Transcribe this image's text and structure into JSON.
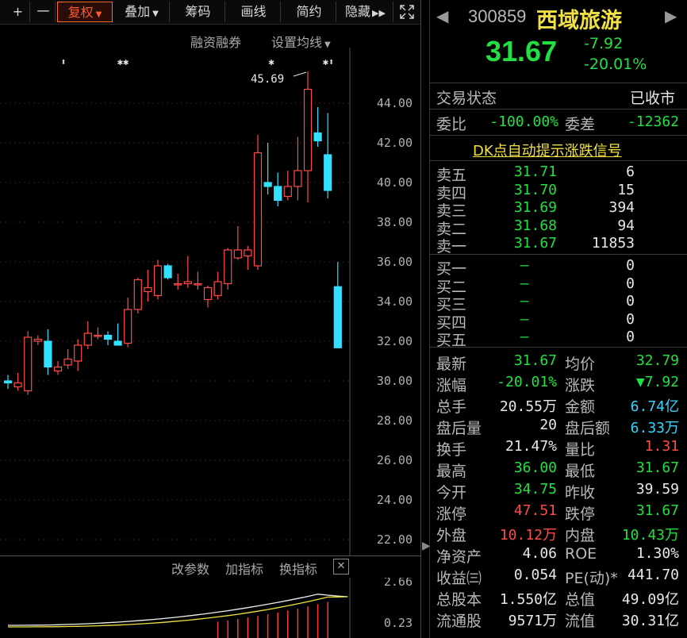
{
  "toolbar": {
    "plus": "+",
    "minus": "一",
    "fuquan": "复权",
    "diejia": "叠加",
    "chouma": "筹码",
    "huaxian": "画线",
    "jianyue": "简约",
    "yincang": "隐藏",
    "expand_icon": "expand-icon"
  },
  "chart_header": {
    "margin_trading": "融资融券",
    "set_ma": "设置均线"
  },
  "chart_data": {
    "type": "candlestick",
    "y_ticks": [
      "44.00",
      "42.00",
      "40.00",
      "38.00",
      "36.00",
      "34.00",
      "32.00",
      "30.00",
      "28.00",
      "26.00",
      "24.00",
      "22.00"
    ],
    "ylim": [
      21.2,
      46.8
    ],
    "high_annotation": "45.69",
    "candles": [
      {
        "o": 30.0,
        "h": 30.3,
        "l": 29.6,
        "c": 29.9
      },
      {
        "o": 29.7,
        "h": 30.4,
        "l": 29.5,
        "c": 29.9
      },
      {
        "o": 29.5,
        "h": 32.5,
        "l": 29.3,
        "c": 32.2
      },
      {
        "o": 32.0,
        "h": 32.3,
        "l": 31.8,
        "c": 32.1
      },
      {
        "o": 32.0,
        "h": 32.6,
        "l": 30.3,
        "c": 30.7
      },
      {
        "o": 30.5,
        "h": 31.0,
        "l": 30.3,
        "c": 30.7
      },
      {
        "o": 30.8,
        "h": 31.6,
        "l": 30.6,
        "c": 31.1
      },
      {
        "o": 31.0,
        "h": 32.1,
        "l": 30.5,
        "c": 31.8
      },
      {
        "o": 31.8,
        "h": 33.0,
        "l": 31.6,
        "c": 32.4
      },
      {
        "o": 32.3,
        "h": 32.7,
        "l": 32.1,
        "c": 32.3
      },
      {
        "o": 32.3,
        "h": 32.5,
        "l": 31.8,
        "c": 32.1
      },
      {
        "o": 32.0,
        "h": 32.9,
        "l": 31.8,
        "c": 31.8
      },
      {
        "o": 31.9,
        "h": 34.2,
        "l": 31.7,
        "c": 33.6
      },
      {
        "o": 33.6,
        "h": 35.2,
        "l": 33.4,
        "c": 35.1
      },
      {
        "o": 34.5,
        "h": 35.6,
        "l": 34.0,
        "c": 34.7
      },
      {
        "o": 34.3,
        "h": 36.1,
        "l": 34.1,
        "c": 35.8
      },
      {
        "o": 35.8,
        "h": 35.9,
        "l": 35.1,
        "c": 35.2
      },
      {
        "o": 34.9,
        "h": 35.4,
        "l": 34.6,
        "c": 34.9
      },
      {
        "o": 34.9,
        "h": 36.3,
        "l": 34.7,
        "c": 35.0
      },
      {
        "o": 34.9,
        "h": 35.5,
        "l": 34.6,
        "c": 34.9
      },
      {
        "o": 34.1,
        "h": 34.8,
        "l": 33.7,
        "c": 34.7
      },
      {
        "o": 34.3,
        "h": 35.5,
        "l": 34.1,
        "c": 35.0
      },
      {
        "o": 34.9,
        "h": 36.7,
        "l": 34.6,
        "c": 36.6
      },
      {
        "o": 36.2,
        "h": 37.8,
        "l": 36.1,
        "c": 36.6
      },
      {
        "o": 36.3,
        "h": 36.8,
        "l": 35.6,
        "c": 36.6
      },
      {
        "o": 35.8,
        "h": 42.4,
        "l": 35.6,
        "c": 41.5
      },
      {
        "o": 40.0,
        "h": 42.0,
        "l": 39.4,
        "c": 39.8
      },
      {
        "o": 39.8,
        "h": 40.5,
        "l": 38.8,
        "c": 39.1
      },
      {
        "o": 39.3,
        "h": 40.6,
        "l": 39.1,
        "c": 39.8
      },
      {
        "o": 39.8,
        "h": 42.3,
        "l": 39.1,
        "c": 40.6
      },
      {
        "o": 40.6,
        "h": 45.6,
        "l": 39.0,
        "c": 44.7
      },
      {
        "o": 42.5,
        "h": 43.8,
        "l": 41.8,
        "c": 42.1
      },
      {
        "o": 41.4,
        "h": 43.5,
        "l": 39.2,
        "c": 39.6
      },
      {
        "o": 34.75,
        "h": 36.0,
        "l": 31.67,
        "c": 31.67
      }
    ],
    "indicator": {
      "y_ticks": [
        "2.66",
        "0.23"
      ],
      "toolbar": [
        "改参数",
        "加指标",
        "换指标"
      ]
    }
  },
  "quote": {
    "code": "300859",
    "name": "西域旅游",
    "price": "31.67",
    "change": "-7.92",
    "change_pct": "-20.01%",
    "status_label": "交易状态",
    "status_value": "已收市",
    "weibi_label": "委比",
    "weibi_value": "-100.00%",
    "weicha_label": "委差",
    "weicha_value": "-12362",
    "dk_link": "DK点自动提示涨跌信号"
  },
  "sell": [
    {
      "label": "卖五",
      "price": "31.71",
      "vol": "6"
    },
    {
      "label": "卖四",
      "price": "31.70",
      "vol": "15"
    },
    {
      "label": "卖三",
      "price": "31.69",
      "vol": "394"
    },
    {
      "label": "卖二",
      "price": "31.68",
      "vol": "94"
    },
    {
      "label": "卖一",
      "price": "31.67",
      "vol": "11853"
    }
  ],
  "buy": [
    {
      "label": "买一",
      "price": "—",
      "vol": "0"
    },
    {
      "label": "买二",
      "price": "—",
      "vol": "0"
    },
    {
      "label": "买三",
      "price": "—",
      "vol": "0"
    },
    {
      "label": "买四",
      "price": "—",
      "vol": "0"
    },
    {
      "label": "买五",
      "price": "—",
      "vol": "0"
    }
  ],
  "stats": [
    {
      "l1": "最新",
      "v1": "31.67",
      "c1": "g",
      "l2": "均价",
      "v2": "32.79",
      "c2": "g"
    },
    {
      "l1": "涨幅",
      "v1": "-20.01%",
      "c1": "g",
      "l2": "涨跌",
      "v2": "▼7.92",
      "c2": "g"
    },
    {
      "l1": "总手",
      "v1": "20.55万",
      "c1": "w",
      "l2": "金额",
      "v2": "6.74亿",
      "c2": "c"
    },
    {
      "l1": "盘后量",
      "v1": "20",
      "c1": "w",
      "l2": "盘后额",
      "v2": "6.33万",
      "c2": "c"
    },
    {
      "l1": "换手",
      "v1": "21.47%",
      "c1": "w",
      "l2": "量比",
      "v2": "1.31",
      "c2": "r"
    },
    {
      "l1": "最高",
      "v1": "36.00",
      "c1": "g",
      "l2": "最低",
      "v2": "31.67",
      "c2": "g"
    },
    {
      "l1": "今开",
      "v1": "34.75",
      "c1": "g",
      "l2": "昨收",
      "v2": "39.59",
      "c2": "w"
    },
    {
      "l1": "涨停",
      "v1": "47.51",
      "c1": "r",
      "l2": "跌停",
      "v2": "31.67",
      "c2": "g"
    },
    {
      "l1": "外盘",
      "v1": "10.12万",
      "c1": "r",
      "l2": "内盘",
      "v2": "10.43万",
      "c2": "g"
    },
    {
      "l1": "净资产",
      "v1": "4.06",
      "c1": "w",
      "l2": "ROE",
      "v2": "1.30%",
      "c2": "w"
    },
    {
      "l1": "收益㈢",
      "v1": "0.054",
      "c1": "w",
      "l2": "PE(动)*",
      "v2": "441.70",
      "c2": "w"
    },
    {
      "l1": "总股本",
      "v1": "1.550亿",
      "c1": "w",
      "l2": "总值",
      "v2": "49.09亿",
      "c2": "w"
    },
    {
      "l1": "流通股",
      "v1": "9571万",
      "c1": "w",
      "l2": "流值",
      "v2": "30.31亿",
      "c2": "w"
    }
  ]
}
